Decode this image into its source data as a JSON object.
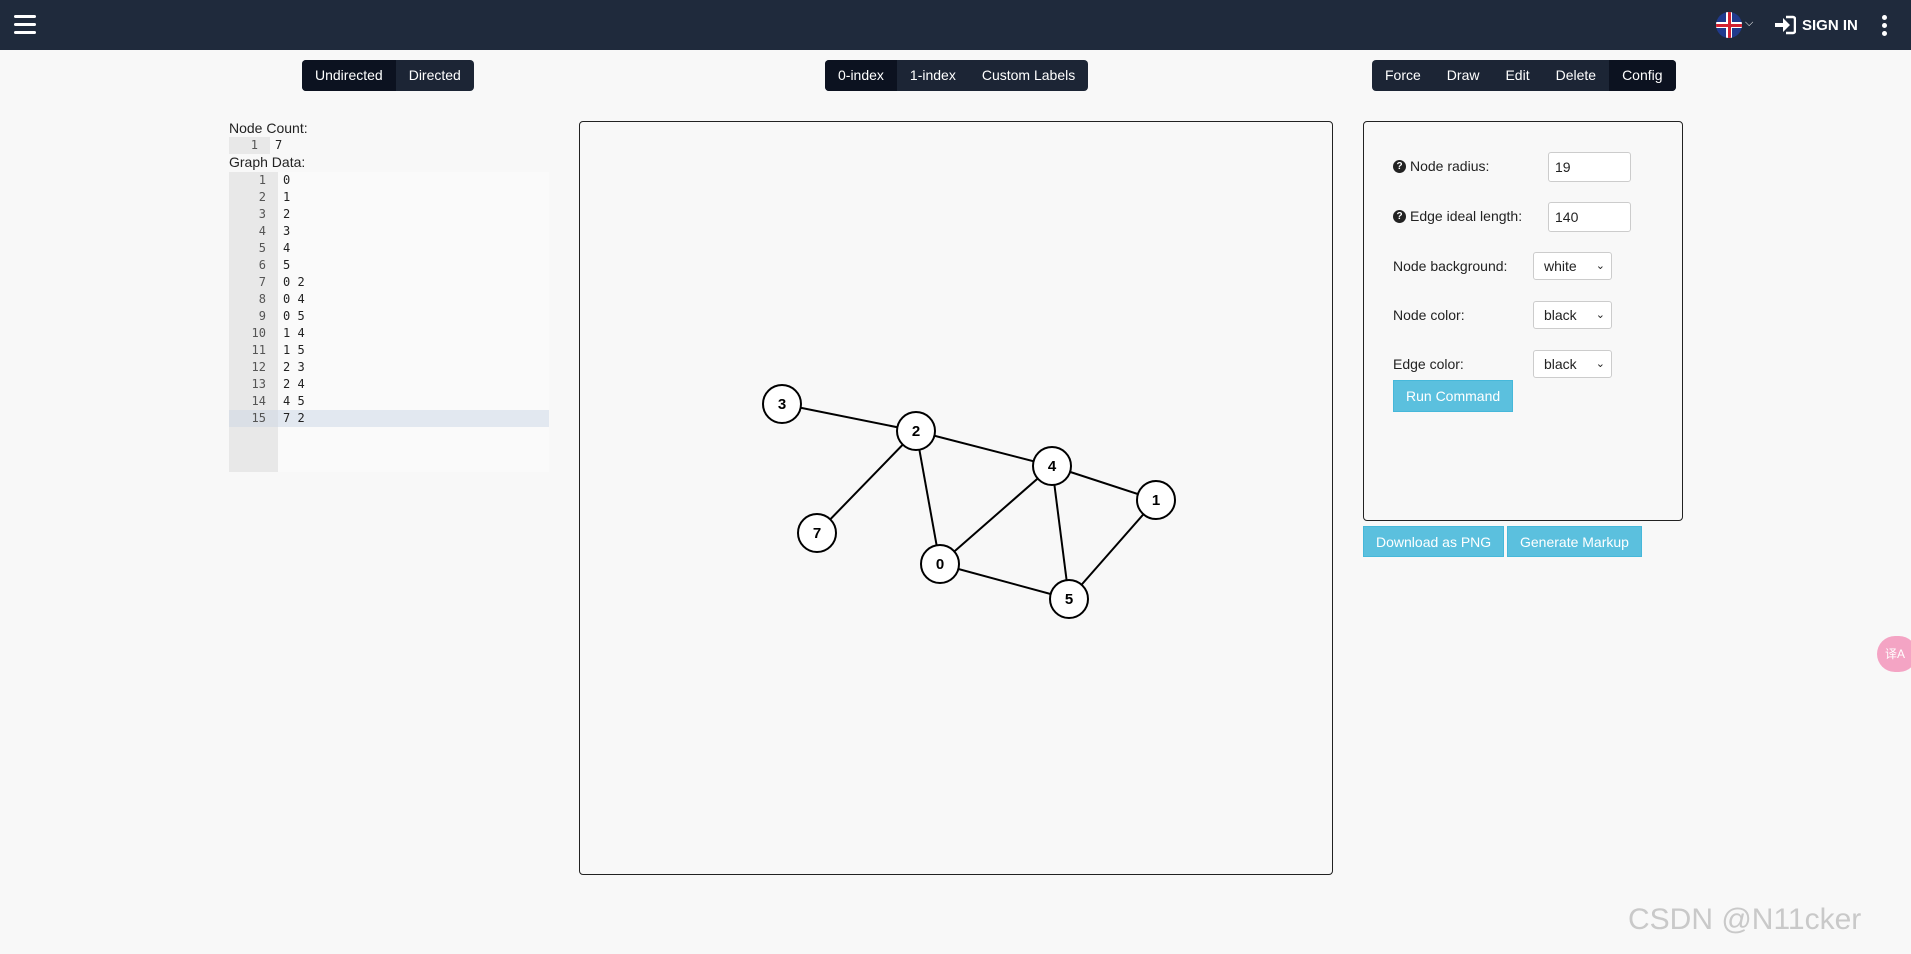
{
  "header": {
    "sign_in": "SIGN IN"
  },
  "graph_type": [
    "Undirected",
    "Directed"
  ],
  "indexing": [
    "0-index",
    "1-index",
    "Custom Labels"
  ],
  "modes": [
    "Force",
    "Draw",
    "Edit",
    "Delete",
    "Config"
  ],
  "input": {
    "node_count_label": "Node Count:",
    "node_count_value": "7",
    "graph_data_label": "Graph Data:",
    "lines": [
      "0",
      "1",
      "2",
      "3",
      "4",
      "5",
      "0 2",
      "0 4",
      "0 5",
      "1 4",
      "1 5",
      "2 3",
      "2 4",
      "4 5",
      "7 2"
    ]
  },
  "graph": {
    "nodes": [
      {
        "id": "0",
        "edges_to": []
      },
      {
        "id": "1"
      },
      {
        "id": "2"
      },
      {
        "id": "3"
      },
      {
        "id": "4"
      },
      {
        "id": "5"
      },
      {
        "id": "7"
      }
    ],
    "edges": [
      [
        "0",
        "2"
      ],
      [
        "0",
        "4"
      ],
      [
        "0",
        "5"
      ],
      [
        "1",
        "4"
      ],
      [
        "1",
        "5"
      ],
      [
        "2",
        "3"
      ],
      [
        "2",
        "4"
      ],
      [
        "4",
        "5"
      ],
      [
        "7",
        "2"
      ]
    ]
  },
  "config": {
    "node_radius_label": "Node radius:",
    "node_radius_value": "19",
    "edge_length_label": "Edge ideal length:",
    "edge_length_value": "140",
    "node_bg_label": "Node background:",
    "node_bg_value": "white",
    "node_color_label": "Node color:",
    "node_color_value": "black",
    "edge_color_label": "Edge color:",
    "edge_color_value": "black",
    "run_command": "Run Command"
  },
  "actions": {
    "download_png": "Download as PNG",
    "generate_markup": "Generate Markup"
  },
  "watermark": "CSDN @N11cker",
  "side_tab": "译A"
}
